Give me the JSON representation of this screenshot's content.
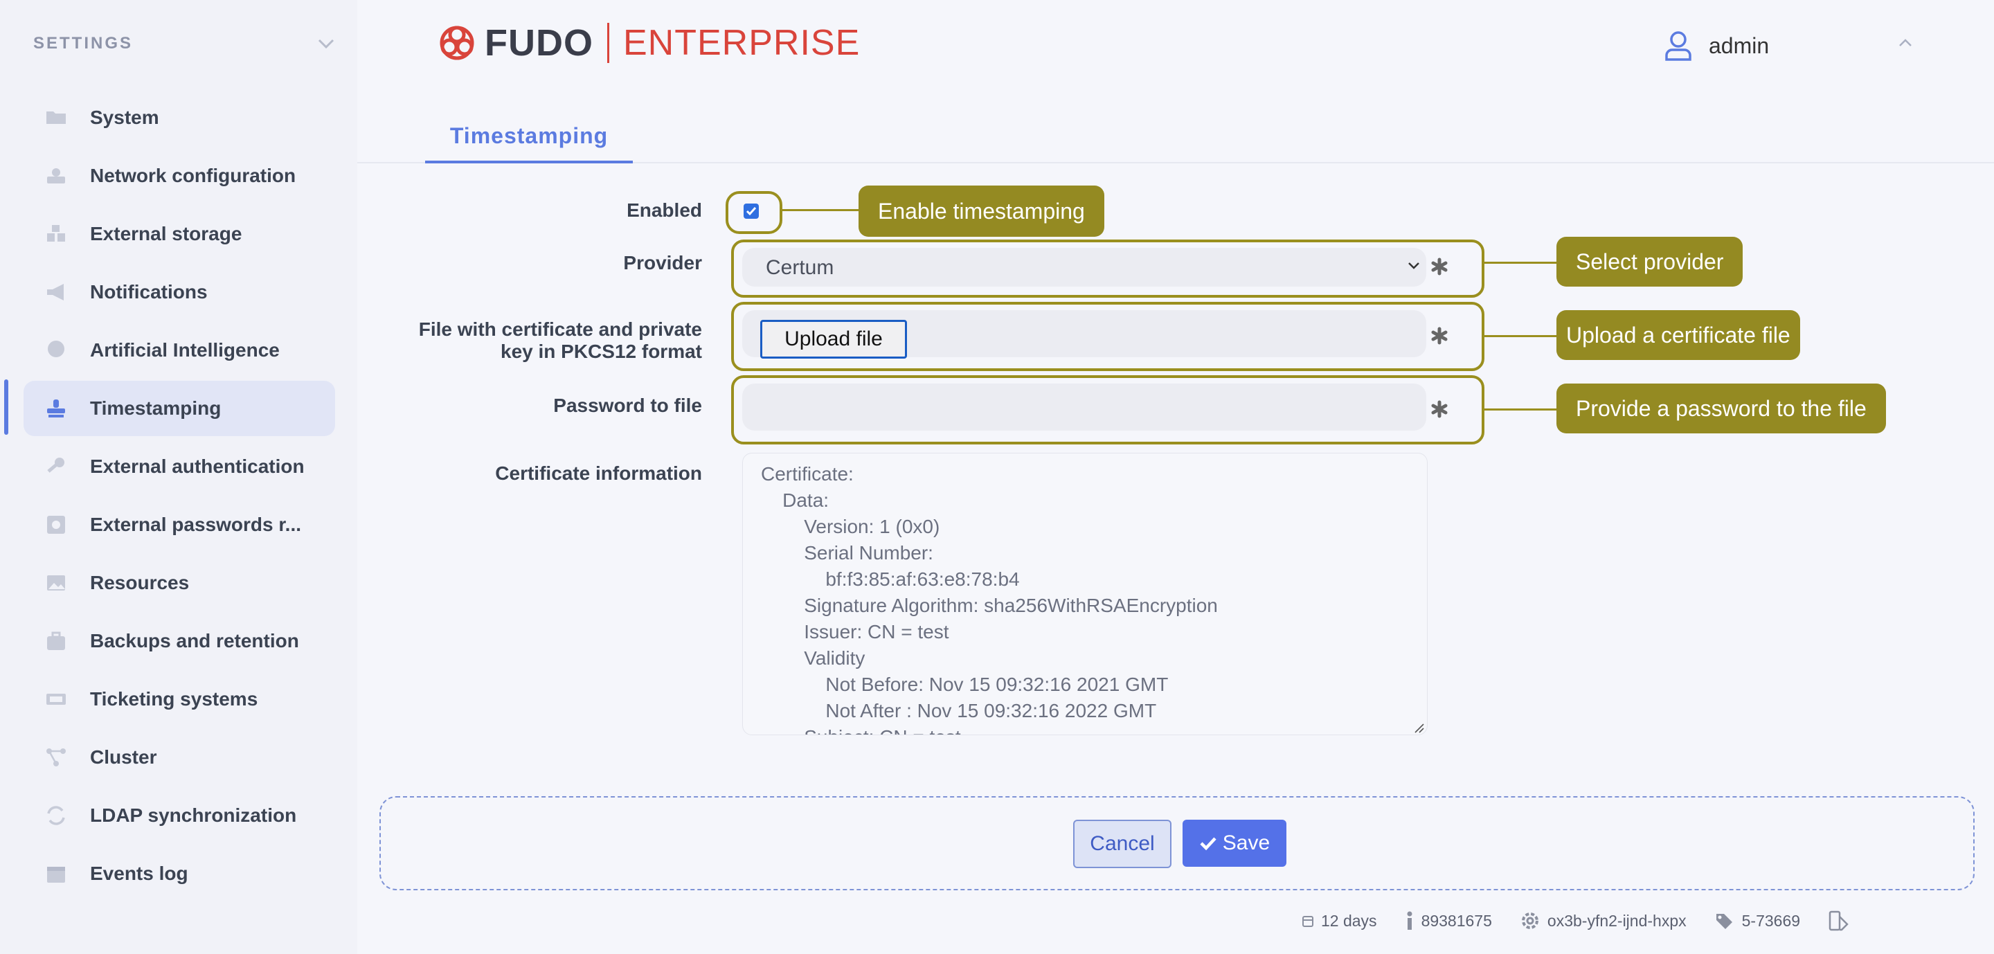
{
  "sidebar": {
    "title": "SETTINGS",
    "items": [
      {
        "label": "System",
        "icon": "folder-icon"
      },
      {
        "label": "Network configuration",
        "icon": "network-icon"
      },
      {
        "label": "External storage",
        "icon": "storage-icon"
      },
      {
        "label": "Notifications",
        "icon": "megaphone-icon"
      },
      {
        "label": "Artificial Intelligence",
        "icon": "brain-icon"
      },
      {
        "label": "Timestamping",
        "icon": "stamp-icon"
      },
      {
        "label": "External authentication",
        "icon": "key-icon"
      },
      {
        "label": "External passwords r...",
        "icon": "vault-icon"
      },
      {
        "label": "Resources",
        "icon": "image-icon"
      },
      {
        "label": "Backups and retention",
        "icon": "briefcase-icon"
      },
      {
        "label": "Ticketing systems",
        "icon": "ticket-icon"
      },
      {
        "label": "Cluster",
        "icon": "cluster-icon"
      },
      {
        "label": "LDAP synchronization",
        "icon": "sync-icon"
      },
      {
        "label": "Events log",
        "icon": "calendar-icon"
      }
    ],
    "active_index": 5
  },
  "header": {
    "brand": "FUDO",
    "edition": "ENTERPRISE",
    "user": "admin"
  },
  "tabs": [
    {
      "label": "Timestamping",
      "active": true
    }
  ],
  "form": {
    "enabled": {
      "label": "Enabled",
      "checked": true
    },
    "provider": {
      "label": "Provider",
      "value": "Certum"
    },
    "certificate_file": {
      "label_line1": "File with certificate and private",
      "label_line2": "key in PKCS12 format",
      "button": "Upload file"
    },
    "password": {
      "label": "Password to file",
      "value": ""
    },
    "certificate_info": {
      "label": "Certificate information",
      "lines": [
        "Certificate:",
        "    Data:",
        "        Version: 1 (0x0)",
        "        Serial Number:",
        "            bf:f3:85:af:63:e8:78:b4",
        "        Signature Algorithm: sha256WithRSAEncryption",
        "        Issuer: CN = test",
        "        Validity",
        "            Not Before: Nov 15 09:32:16 2021 GMT",
        "            Not After : Nov 15 09:32:16 2022 GMT",
        "        Subject: CN = test"
      ]
    }
  },
  "callouts": {
    "enabled": "Enable timestamping",
    "provider": "Select provider",
    "certificate": "Upload a certificate file",
    "password": "Provide a password to the file"
  },
  "actions": {
    "cancel": "Cancel",
    "save": "Save"
  },
  "status": {
    "uptime": "12 days",
    "build": "89381675",
    "system_id": "ox3b-yfn2-ijnd-hxpx",
    "version": "5-73669"
  },
  "colors": {
    "accent": "#5b7be0",
    "brand_red": "#d9443b",
    "callout": "#948a22"
  }
}
